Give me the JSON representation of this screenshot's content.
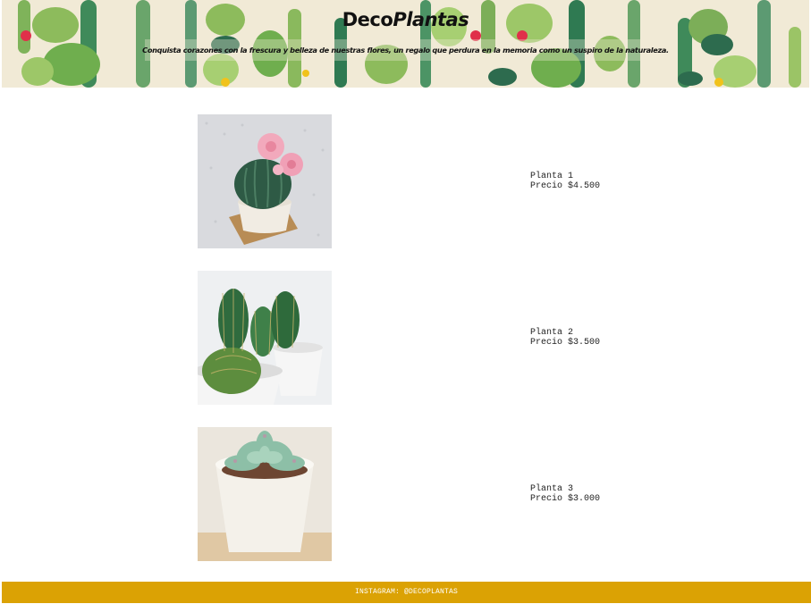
{
  "header": {
    "brand_part1": "Deco",
    "brand_part2": "Plantas",
    "tagline": "Conquista corazones con la frescura y belleza de nuestras flores, un regalo que perdura en la memoria como un suspiro de la naturaleza."
  },
  "products": [
    {
      "name": "Planta 1",
      "price": "Precio $4.500",
      "image": "flowering-barrel-cactus-photo"
    },
    {
      "name": "Planta 2",
      "price": "Precio $3.500",
      "image": "small-cacti-in-white-pots-photo"
    },
    {
      "name": "Planta 3",
      "price": "Precio $3.000",
      "image": "echeveria-succulent-photo"
    }
  ],
  "footer": {
    "text": "INSTAGRAM: @DECOPLANTAS"
  },
  "colors": {
    "footer_bg": "#dba204",
    "header_bg": "#f0e8d4"
  }
}
